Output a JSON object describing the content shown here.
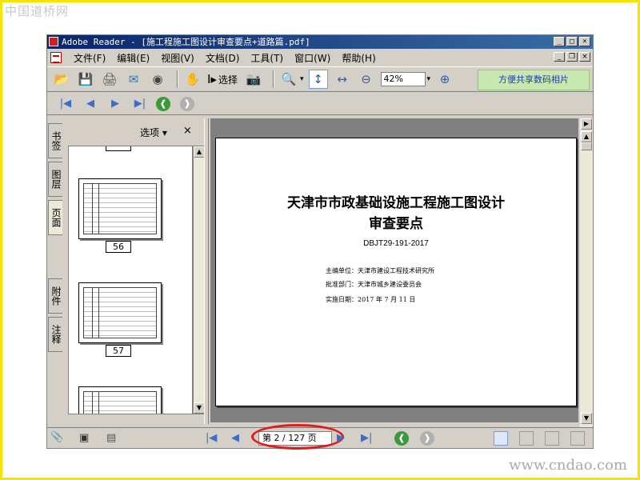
{
  "watermarks": {
    "top": "中国道桥网",
    "bottom": "www.cndao.com"
  },
  "window": {
    "title": "Adobe Reader - [施工程施工图设计审查要点+道路篇.pdf]",
    "controls": [
      "_",
      "□",
      "×"
    ]
  },
  "menubar": {
    "items": [
      "文件(F)",
      "编辑(E)",
      "视图(V)",
      "文档(D)",
      "工具(T)",
      "窗口(W)",
      "帮助(H)"
    ],
    "doc_controls": [
      "_",
      "❐",
      "×"
    ]
  },
  "toolbar": {
    "select_label": "选择",
    "zoom_value": "42%",
    "share_label": "方便共享数码相片"
  },
  "panel": {
    "options_label": "选项 ▾",
    "close_label": "×",
    "tabs": [
      "书签",
      "图层",
      "页面",
      "附件",
      "注释"
    ],
    "thumbnails": [
      {
        "label": "56"
      },
      {
        "label": "57"
      }
    ]
  },
  "document": {
    "title_line1": "天津市市政基础设施工程施工图设计",
    "title_line2": "审查要点",
    "code": "DBJT29-191-2017",
    "editor": "主编单位：天津市建设工程技术研究所",
    "approver": "批准部门：天津市城乡建设委员会",
    "date": "实施日期：2017 年 7 月 11 日"
  },
  "status": {
    "page_indicator": "第 2 / 127 页",
    "highlight_color": "#e11a1a"
  },
  "colors": {
    "frame": "#f3e600",
    "titlebar": "#0a246a",
    "share_bg": "#c9e7b0",
    "nav_blue": "#3a6ec8"
  }
}
